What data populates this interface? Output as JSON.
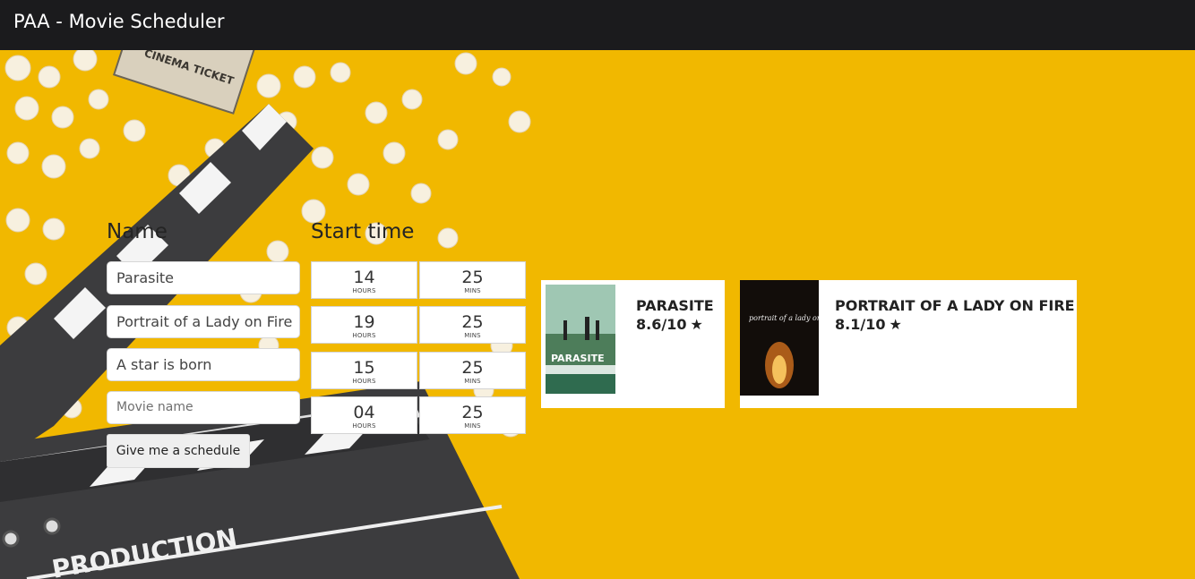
{
  "header": {
    "title": "PAA - Movie Scheduler"
  },
  "background": {
    "ticket_text": "CINEMA TICKET",
    "clapper_text": "PRODUCTION"
  },
  "form": {
    "name_label": "Name",
    "start_time_label": "Start time",
    "movies": [
      {
        "name": "Parasite",
        "hours": "14",
        "mins": "25"
      },
      {
        "name": "Portrait of a Lady on Fire",
        "hours": "19",
        "mins": "25"
      },
      {
        "name": "A star is born",
        "hours": "15",
        "mins": "25"
      },
      {
        "name": "",
        "placeholder": "Movie name",
        "hours": "04",
        "mins": "25"
      }
    ],
    "hours_unit": "HOURS",
    "mins_unit": "MINS",
    "submit_label": "Give me a schedule"
  },
  "results": [
    {
      "title": "PARASITE",
      "rating": "8.6/10",
      "poster_text": "PARASITE"
    },
    {
      "title": "PORTRAIT OF A LADY ON FIRE",
      "rating": "8.1/10",
      "poster_text": "portrait of a lady on fire"
    }
  ],
  "colors": {
    "background": "#f1b800",
    "header": "#1b1b1d"
  },
  "icons": {
    "rating": "star-icon"
  }
}
